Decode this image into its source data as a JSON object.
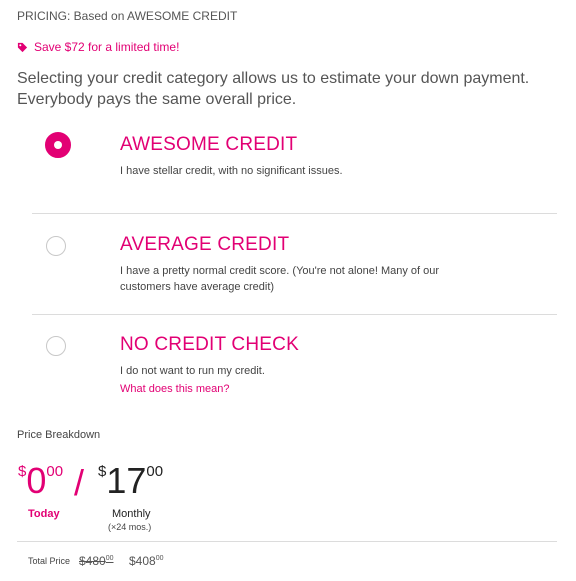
{
  "header": {
    "pricing_label": "PRICING: Based on AWESOME CREDIT"
  },
  "promo": {
    "icon": "tag-icon",
    "text": "Save $72 for a limited time!",
    "color": "#e20074"
  },
  "intro": {
    "line1": "Selecting your credit category allows us to estimate your down payment.",
    "line2": "Everybody pays the same overall price."
  },
  "options": [
    {
      "title": "AWESOME CREDIT",
      "description": "I have stellar credit, with no significant issues.",
      "selected": true
    },
    {
      "title": "AVERAGE CREDIT",
      "description_line1": "I have a pretty normal credit score. (You're not alone! Many of our",
      "description_line2": "customers have average credit)",
      "selected": false
    },
    {
      "title": "NO CREDIT CHECK",
      "description": "I do not want to run my credit.",
      "link": "What does this mean?",
      "selected": false
    }
  ],
  "breakdown": {
    "label": "Price Breakdown",
    "today": {
      "currency": "$",
      "dollars": "0",
      "cents": "00",
      "label": "Today"
    },
    "separator": "/",
    "monthly": {
      "currency": "$",
      "dollars": "17",
      "cents": "00",
      "label": "Monthly",
      "term": "(×24 mos.)"
    },
    "total": {
      "label": "Total Price",
      "old": {
        "dollars": "$480",
        "cents": "00"
      },
      "new": {
        "dollars": "$408",
        "cents": "00"
      }
    }
  },
  "colors": {
    "brand": "#e20074"
  }
}
